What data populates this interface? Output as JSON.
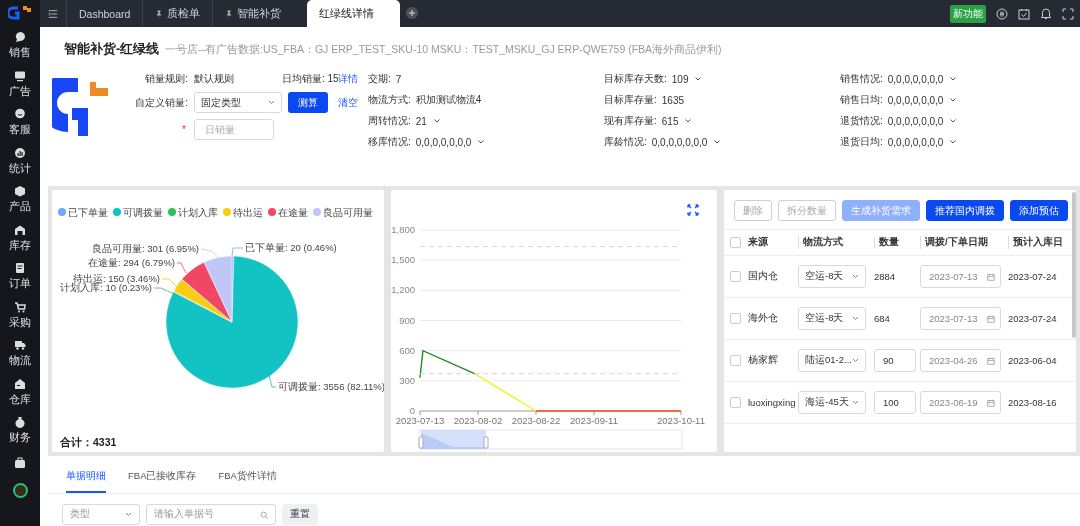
{
  "sidebar": {
    "items": [
      {
        "label": "销售"
      },
      {
        "label": "广告"
      },
      {
        "label": "客服"
      },
      {
        "label": "统计"
      },
      {
        "label": "产品"
      },
      {
        "label": "库存"
      },
      {
        "label": "订单"
      },
      {
        "label": "采购"
      },
      {
        "label": "物流"
      },
      {
        "label": "仓库"
      },
      {
        "label": "财务"
      }
    ]
  },
  "tabs": [
    {
      "label": "Dashboard",
      "pinned": false,
      "selected": false
    },
    {
      "label": "质检单",
      "pinned": true,
      "selected": false
    },
    {
      "label": "智能补货",
      "pinned": true,
      "selected": false
    },
    {
      "label": "红绿线详情",
      "pinned": false,
      "selected": true
    }
  ],
  "top_badge": "新功能",
  "title": "智能补货-红绿线",
  "subtitle": "一号店--有广告数据:US_FBA：GJ ERP_TEST_SKU-10 MSKU：TEST_MSKU_GJ ERP-QWE759   (FBA海外商品伊利)",
  "rule": {
    "label": "销量规则:",
    "value": "默认规则"
  },
  "daily": {
    "label": "日均销量:",
    "value": "15",
    "link": "详情"
  },
  "custom": {
    "label": "自定义销量:",
    "value": "固定类型",
    "button": "测算",
    "link": "清空"
  },
  "daily_input": {
    "required_mark": "*",
    "placeholder": "日销量"
  },
  "info_columns": [
    [
      {
        "label": "交期:",
        "value": "7",
        "expandable": false
      },
      {
        "label": "物流方式:",
        "value": "积加测试物流4",
        "expandable": false
      },
      {
        "label": "周转情况:",
        "value": "21",
        "expandable": true
      },
      {
        "label": "移库情况:",
        "value": "0,0,0,0,0,0,0",
        "expandable": true
      }
    ],
    [
      {
        "label": "目标库存天数:",
        "value": "109",
        "expandable": true
      },
      {
        "label": "目标库存量:",
        "value": "1635",
        "expandable": false
      },
      {
        "label": "现有库存量:",
        "value": "615",
        "expandable": true
      },
      {
        "label": "库龄情况:",
        "value": "0,0,0,0,0,0,0",
        "expandable": true
      }
    ],
    [
      {
        "label": "销售情况:",
        "value": "0,0,0,0,0,0,0",
        "expandable": true
      },
      {
        "label": "销售日均:",
        "value": "0,0,0,0,0,0,0",
        "expandable": true
      },
      {
        "label": "退货情况:",
        "value": "0,0,0,0,0,0,0",
        "expandable": true
      },
      {
        "label": "退货日均:",
        "value": "0,0,0,0,0,0,0",
        "expandable": true
      }
    ]
  ],
  "pie": {
    "chart_data": {
      "type": "pie",
      "categories": [
        "已下单量",
        "可调拨量",
        "计划入库",
        "待出运",
        "在途量",
        "良品可用量"
      ],
      "values": [
        20,
        3556,
        10,
        150,
        294,
        301
      ],
      "legend": true,
      "colors": [
        "#73a6ff",
        "#13c2c2",
        "#2fc25b",
        "#facc14",
        "#f04864",
        "#c1c6f8"
      ],
      "value_labels": [
        "已下单量: 20 (0.46%)",
        "可调拨量: 3556 (82.11%)",
        "计划入库: 10 (0.23%)",
        "待出运: 150 (3.46%)",
        "在途量: 294 (6.79%)",
        "良品可用量: 301 (6.95%)"
      ]
    },
    "total": "合计：4331"
  },
  "line": {
    "chart_data": {
      "type": "line",
      "x": [
        "2023-07-13",
        "2023-07-14",
        "2023-08-01",
        "2023-08-22",
        "2023-10-11"
      ],
      "series": [
        {
          "color": "#1e8c1e",
          "values": [
            330,
            600,
            370,
            null,
            null
          ]
        },
        {
          "color": "#f2f21a",
          "values": [
            null,
            null,
            370,
            0,
            null
          ]
        },
        {
          "color": "#ff4a1a",
          "values": [
            null,
            null,
            null,
            0,
            0
          ]
        },
        {
          "color": "#d4d4d4",
          "line_style": "dashed",
          "values": [
            1635,
            1635,
            1635,
            1635,
            1635
          ]
        },
        {
          "color": "#d4d4d4",
          "line_style": "dashed",
          "values": [
            370,
            370,
            370,
            370,
            370
          ]
        }
      ],
      "grid": true,
      "xlim": [
        "2023-07-13",
        "2023-10-11"
      ],
      "ylim": [
        0,
        1800
      ],
      "xticks": [
        "2023-07-13",
        "2023-08-02",
        "2023-08-22",
        "2023-09-11",
        "2023-10-11"
      ],
      "yticks": [
        {
          "value": 0,
          "label": "0"
        },
        {
          "value": 300,
          "label": "300"
        },
        {
          "value": 600,
          "label": "600"
        },
        {
          "value": 900,
          "label": "900"
        },
        {
          "value": 1200,
          "label": "1,200"
        },
        {
          "value": 1500,
          "label": "1,500"
        },
        {
          "value": 1800,
          "label": "1,800"
        }
      ]
    }
  },
  "actions": [
    {
      "label": "删除",
      "kind": "outline",
      "disabled": true
    },
    {
      "label": "拆分数量",
      "kind": "outline",
      "disabled": true
    },
    {
      "label": "生成补货需求",
      "kind": "primary",
      "disabled": true
    },
    {
      "label": "推荐国内调拨",
      "kind": "primary",
      "disabled": false
    },
    {
      "label": "添加预估",
      "kind": "primary",
      "disabled": false
    }
  ],
  "table": {
    "all_checked": false,
    "columns": [
      "来源",
      "物流方式",
      "数量",
      "调拨/下单日期",
      "预计入库日"
    ],
    "rows": [
      {
        "checked": false,
        "source": "国内仓",
        "shipping": "空运-8天",
        "qty": "2884",
        "qty_editable": false,
        "date": "2023-07-13",
        "arrival": "2023-07-24"
      },
      {
        "checked": false,
        "source": "海外仓",
        "shipping": "空运-8天",
        "qty": "684",
        "qty_editable": false,
        "date": "2023-07-13",
        "arrival": "2023-07-24"
      },
      {
        "checked": false,
        "source": "杨家辉",
        "shipping": "陆运01-2...",
        "qty": "90",
        "qty_editable": true,
        "date": "2023-04-26",
        "arrival": "2023-06-04"
      },
      {
        "checked": false,
        "source": "luoxingxing",
        "shipping": "海运-45天",
        "qty": "100",
        "qty_editable": true,
        "date": "2023-06-19",
        "arrival": "2023-08-16"
      }
    ]
  },
  "bottom_tabs": [
    {
      "label": "单据明细",
      "selected": true
    },
    {
      "label": "FBA已接收库存",
      "selected": false
    },
    {
      "label": "FBA货件详情",
      "selected": false
    }
  ],
  "filters": {
    "type_placeholder": "类型",
    "search_placeholder": "请输入单据号",
    "reset": "重置"
  }
}
